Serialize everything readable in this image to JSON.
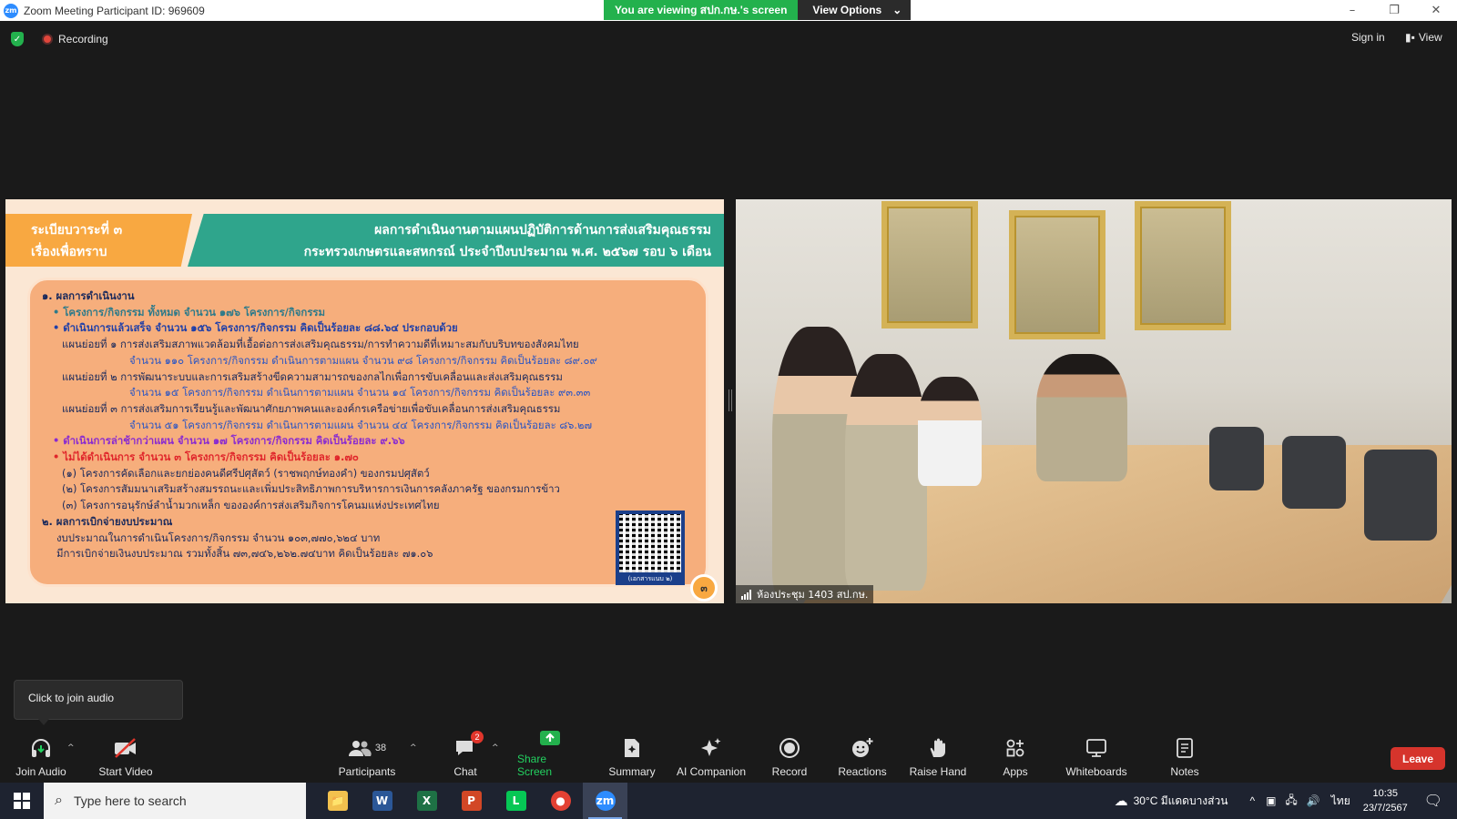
{
  "window": {
    "title": "Zoom Meeting Participant ID: 969609",
    "logo_text": "zm",
    "controls": [
      "–",
      "❐",
      "✕"
    ]
  },
  "viewing_bar": {
    "message": "You are viewing สปก.กษ.'s screen",
    "options_label": "View Options",
    "options_caret": "⌄"
  },
  "topbar": {
    "recording_label": "Recording",
    "sign_in_label": "Sign in",
    "view_label": "View"
  },
  "slide": {
    "header_left": [
      "ระเบียบวาระที่ ๓",
      "เรื่องเพื่อทราบ"
    ],
    "header_right": [
      "ผลการดำเนินงานตามแผนปฏิบัติการด้านการส่งเสริมคุณธรรม",
      "กระทรวงเกษตรและสหกรณ์ ประจำปีงบประมาณ พ.ศ. ๒๕๖๗ รอบ ๖ เดือน"
    ],
    "lines": [
      {
        "text": "๑. ผลการดำเนินงาน",
        "color": "#1b2a5c",
        "bold": true,
        "indent": 0
      },
      {
        "text": "• โครงการ/กิจกรรม ทั้งหมด จำนวน ๑๗๖ โครงการ/กิจกรรม",
        "color": "#2d7a8a",
        "bold": true,
        "indent": 12
      },
      {
        "text": "• ดำเนินการแล้วเสร็จ จำนวน ๑๕๖ โครงการ/กิจกรรม คิดเป็นร้อยละ ๘๘.๖๔ ประกอบด้วย",
        "color": "#1f3fa8",
        "bold": true,
        "indent": 12
      },
      {
        "text": "แผนย่อยที่ ๑  การส่งเสริมสภาพแวดล้อมที่เอื้อต่อการส่งเสริมคุณธรรม/การทำความดีที่เหมาะสมกับบริบทของสังคมไทย",
        "color": "#1b2a5c",
        "bold": false,
        "indent": 22
      },
      {
        "text": "จำนวน ๑๑๐ โครงการ/กิจกรรม ดำเนินการตามแผน จำนวน ๙๘ โครงการ/กิจกรรม คิดเป็นร้อยละ ๘๙.๐๙",
        "color": "#2a55c4",
        "bold": false,
        "indent": 96
      },
      {
        "text": "แผนย่อยที่ ๒  การพัฒนาระบบและการเสริมสร้างขีดความสามารถของกลไกเพื่อการขับเคลื่อนและส่งเสริมคุณธรรม",
        "color": "#1b2a5c",
        "bold": false,
        "indent": 22
      },
      {
        "text": "จำนวน ๑๕ โครงการ/กิจกรรม ดำเนินการตามแผน จำนวน ๑๔ โครงการ/กิจกรรม คิดเป็นร้อยละ ๙๓.๓๓",
        "color": "#2a55c4",
        "bold": false,
        "indent": 96
      },
      {
        "text": "แผนย่อยที่ ๓  การส่งเสริมการเรียนรู้และพัฒนาศักยภาพคนและองค์กรเครือข่ายเพื่อขับเคลื่อนการส่งเสริมคุณธรรม",
        "color": "#1b2a5c",
        "bold": false,
        "indent": 22
      },
      {
        "text": "จำนวน ๕๑ โครงการ/กิจกรรม ดำเนินการตามแผน จำนวน ๔๔ โครงการ/กิจกรรม คิดเป็นร้อยละ ๘๖.๒๗",
        "color": "#2a55c4",
        "bold": false,
        "indent": 96
      },
      {
        "text": "• ดำเนินการล่าช้ากว่าแผน จำนวน ๑๗ โครงการ/กิจกรรม คิดเป็นร้อยละ ๙.๖๖",
        "color": "#8a2bd0",
        "bold": true,
        "indent": 12
      },
      {
        "text": "• ไม่ได้ดำเนินการ จำนวน ๓ โครงการ/กิจกรรม คิดเป็นร้อยละ ๑.๗๐",
        "color": "#e0262b",
        "bold": true,
        "indent": 12
      },
      {
        "text": "(๑) โครงการคัดเลือกและยกย่องคนดีศรีปศุสัตว์ (ราชพฤกษ์ทองคำ) ของกรมปศุสัตว์",
        "color": "#1b2a5c",
        "bold": false,
        "indent": 22
      },
      {
        "text": "(๒) โครงการสัมมนาเสริมสร้างสมรรถนะและเพิ่มประสิทธิภาพการบริหารการเงินการคลังภาครัฐ ของกรมการข้าว",
        "color": "#1b2a5c",
        "bold": false,
        "indent": 22
      },
      {
        "text": "(๓) โครงการอนุรักษ์ลำน้ำมวกเหล็ก ขององค์การส่งเสริมกิจการโคนมแห่งประเทศไทย",
        "color": "#1b2a5c",
        "bold": false,
        "indent": 22
      },
      {
        "text": "",
        "color": "#1b2a5c",
        "bold": false,
        "indent": 0
      },
      {
        "text": "๒. ผลการเบิกจ่ายงบประมาณ",
        "color": "#1b2a5c",
        "bold": true,
        "indent": 0
      },
      {
        "text": "งบประมาณในการดำเนินโครงการ/กิจกรรม จำนวน ๑๐๓,๗๗๐,๖๒๔ บาท",
        "color": "#1b2a5c",
        "bold": false,
        "indent": 16
      },
      {
        "text": "มีการเบิกจ่ายเงินงบประมาณ รวมทั้งสิ้น ๗๓,๗๔๖,๒๖๒.๗๔บาท คิดเป็นร้อยละ ๗๑.๐๖",
        "color": "#1b2a5c",
        "bold": false,
        "indent": 16
      }
    ],
    "qr_caption": "(เอกสารแนบ ๒)",
    "page_number": "๓"
  },
  "video": {
    "participant_name": "ห้องประชุม 1403 สป.กษ."
  },
  "audio_tooltip": "Click to join audio",
  "toolbar": {
    "join_audio": "Join Audio",
    "start_video": "Start Video",
    "participants": "Participants",
    "participants_count": "38",
    "chat": "Chat",
    "chat_badge": "2",
    "share_screen": "Share Screen",
    "summary": "Summary",
    "ai_companion": "AI Companion",
    "record": "Record",
    "reactions": "Reactions",
    "raise_hand": "Raise Hand",
    "apps": "Apps",
    "whiteboards": "Whiteboards",
    "notes": "Notes",
    "leave": "Leave",
    "caret": "^"
  },
  "taskbar": {
    "search_placeholder": "Type here to search",
    "apps": [
      {
        "name": "file-explorer",
        "letter": "📁",
        "color": "#f2c14e"
      },
      {
        "name": "word",
        "letter": "W",
        "color": "#2b5797"
      },
      {
        "name": "excel",
        "letter": "X",
        "color": "#1e7145"
      },
      {
        "name": "powerpoint",
        "letter": "P",
        "color": "#d24726"
      },
      {
        "name": "line",
        "letter": "L",
        "color": "#06c755"
      },
      {
        "name": "chrome",
        "letter": "●",
        "color": "#e34133"
      },
      {
        "name": "zoom",
        "letter": "zm",
        "color": "#2d8cff"
      }
    ],
    "weather": "30°C  มีแดดบางส่วน",
    "language": "ไทย",
    "time": "10:35",
    "date": "23/7/2567"
  }
}
